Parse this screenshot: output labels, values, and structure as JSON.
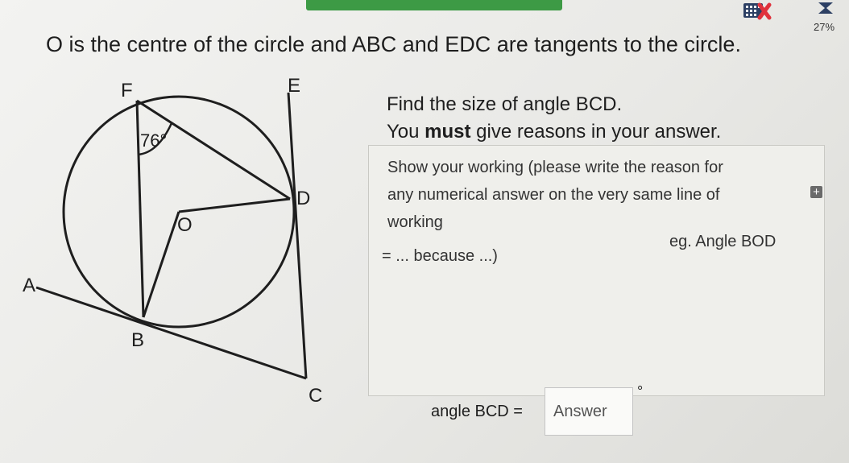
{
  "header": {
    "progress_text": "27%",
    "accent_color": "#3d9a45",
    "icons": [
      "calculator-disallowed-icon",
      "hourglass-progress-icon"
    ]
  },
  "question": {
    "statement": "O is the centre of the circle and ABC and EDC are tangents to the circle.",
    "task_line1": "Find the size of angle BCD.",
    "task_line2_prefix": "You ",
    "task_line2_bold": "must",
    "task_line2_suffix": " give reasons in your answer."
  },
  "diagram": {
    "labels": {
      "F": "F",
      "E": "E",
      "D": "D",
      "O": "O",
      "A": "A",
      "B": "B",
      "C": "C"
    },
    "angle_label": "76°"
  },
  "working": {
    "line1": "Show your working (please write the reason for",
    "line2": "any numerical answer on the very same line of",
    "line3": "working",
    "line3_right": "eg. Angle BOD",
    "line4": "= ... because ...)"
  },
  "answer": {
    "label": "angle BCD =",
    "placeholder": "Answer",
    "unit": "°"
  }
}
